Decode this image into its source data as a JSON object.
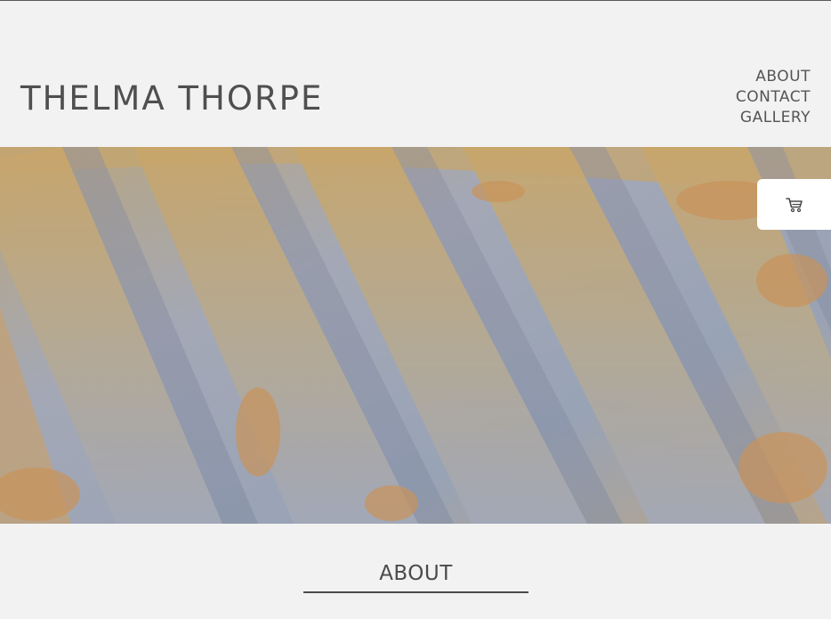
{
  "site": {
    "title": "THELMA THORPE"
  },
  "nav": {
    "items": [
      "ABOUT",
      "CONTACT",
      "GALLERY"
    ]
  },
  "hero": {
    "alt": ""
  },
  "cart": {
    "icon": "cart-icon"
  },
  "sections": {
    "about_heading": "ABOUT"
  },
  "colors": {
    "background": "#f2f2f2",
    "text": "#4a4a4a",
    "cart_bg": "#ffffff"
  }
}
